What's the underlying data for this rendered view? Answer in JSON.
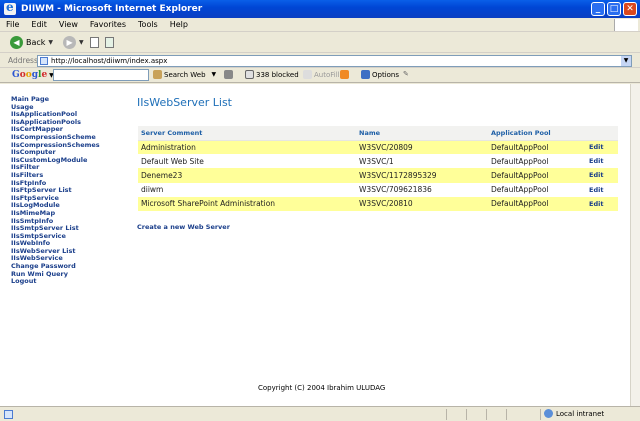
{
  "window": {
    "title": "DIIWM - Microsoft Internet Explorer",
    "minimize": "_",
    "maximize": "□",
    "close": "✕"
  },
  "menu": [
    "File",
    "Edit",
    "View",
    "Favorites",
    "Tools",
    "Help"
  ],
  "toolbar": {
    "back_label": "Back",
    "back_icon": "back-arrow-icon",
    "forward_icon": "forward-arrow-icon"
  },
  "address": {
    "label": "Address",
    "url": "http://localhost/diiwm/index.aspx"
  },
  "google_toolbar": {
    "logo": [
      "G",
      "o",
      "o",
      "g",
      "l",
      "e"
    ],
    "search_web": "Search Web",
    "blocked": "338 blocked",
    "autofill": "AutoFill",
    "options": "Options"
  },
  "sidebar": {
    "items": [
      "Main Page",
      "Usage",
      "IIsApplicationPool",
      "IIsApplicationPools",
      "IIsCertMapper",
      "IIsCompressionScheme",
      "IIsCompressionSchemes",
      "IIsComputer",
      "IIsCustomLogModule",
      "IIsFilter",
      "IIsFilters",
      "IIsFtpInfo",
      "IIsFtpServer List",
      "IIsFtpService",
      "IIsLogModule",
      "IIsMimeMap",
      "IIsSmtpInfo",
      "IIsSmtpServer List",
      "IIsSmtpService",
      "IIsWebInfo",
      "IIsWebServer List",
      "IIsWebService",
      "Change Password",
      "Run Wmi Query",
      "Logout"
    ]
  },
  "main": {
    "heading": "IIsWebServer List",
    "columns": [
      "Server Comment",
      "Name",
      "Application Pool",
      ""
    ],
    "rows": [
      {
        "comment": "Administration",
        "name": "W3SVC/20809",
        "pool": "DefaultAppPool",
        "action": "Edit",
        "highlight": true
      },
      {
        "comment": "Default Web Site",
        "name": "W3SVC/1",
        "pool": "DefaultAppPool",
        "action": "Edit",
        "highlight": false
      },
      {
        "comment": "Deneme23",
        "name": "W3SVC/1172895329",
        "pool": "DefaultAppPool",
        "action": "Edit",
        "highlight": true
      },
      {
        "comment": "diiwm",
        "name": "W3SVC/709621836",
        "pool": "DefaultAppPool",
        "action": "Edit",
        "highlight": false
      },
      {
        "comment": "Microsoft SharePoint Administration",
        "name": "W3SVC/20810",
        "pool": "DefaultAppPool",
        "action": "Edit",
        "highlight": true
      }
    ],
    "create_link": "Create a new Web Server",
    "footer": "Copyright (C) 2004 Ibrahim ULUDAG"
  },
  "status": {
    "zone": "Local intranet"
  },
  "colors": {
    "title_bar": "#0046d5",
    "link": "#1a3e8a",
    "heading": "#1e6fb8",
    "row_highlight": "#ffff99"
  }
}
